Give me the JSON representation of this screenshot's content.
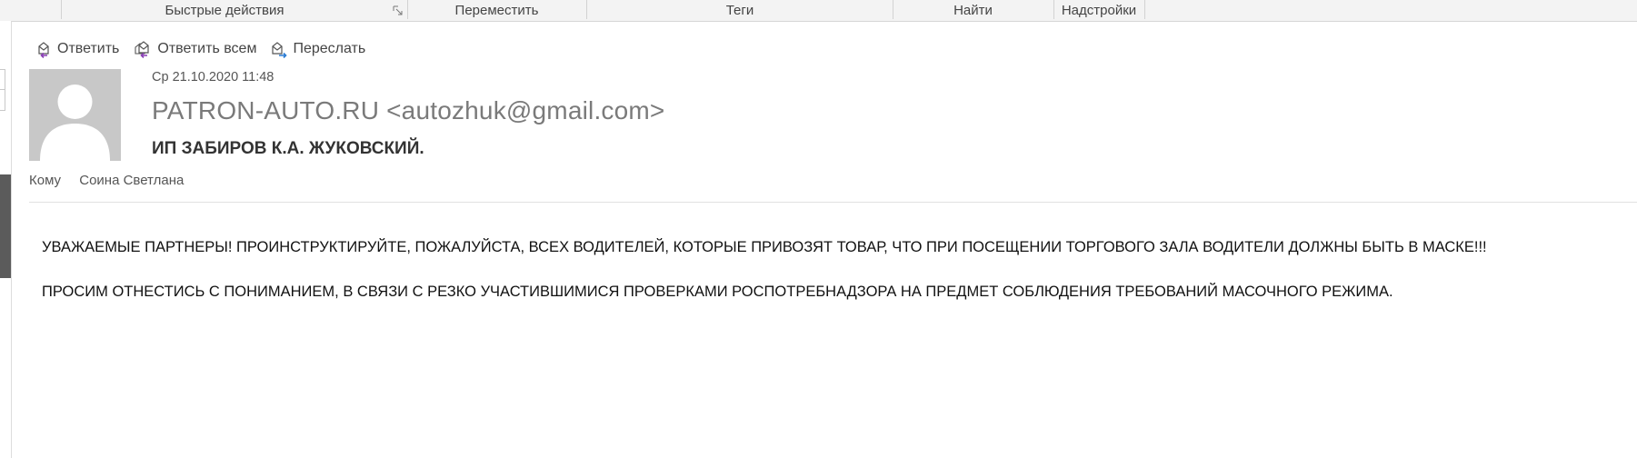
{
  "ribbon": {
    "groups": [
      {
        "label": "Быстрые действия"
      },
      {
        "label": "Переместить"
      },
      {
        "label": "Теги"
      },
      {
        "label": "Найти"
      },
      {
        "label": "Надстройки"
      }
    ]
  },
  "actions": {
    "reply": {
      "label": "Ответить",
      "icon": "reply-icon"
    },
    "reply_all": {
      "label": "Ответить всем",
      "icon": "reply-all-icon"
    },
    "forward": {
      "label": "Переслать",
      "icon": "forward-icon"
    }
  },
  "message": {
    "date": "Ср 21.10.2020 11:48",
    "sender": "PATRON-AUTO.RU <autozhuk@gmail.com>",
    "subject": "ИП ЗАБИРОВ К.А. ЖУКОВСКИЙ.",
    "to_label": "Кому",
    "to_value": "Соина Светлана",
    "body": [
      "УВАЖАЕМЫЕ ПАРТНЕРЫ! ПРОИНСТРУКТИРУЙТЕ, ПОЖАЛУЙСТА, ВСЕХ ВОДИТЕЛЕЙ, КОТОРЫЕ ПРИВОЗЯТ ТОВАР, ЧТО ПРИ ПОСЕЩЕНИИ ТОРГОВОГО ЗАЛА ВОДИТЕЛИ ДОЛЖНЫ БЫТЬ В МАСКЕ!!!",
      "ПРОСИМ ОТНЕСТИСЬ С ПОНИМАНИЕМ, В СВЯЗИ С РЕЗКО УЧАСТИВШИМИСЯ ПРОВЕРКАМИ РОСПОТРЕБНАДЗОРА НА ПРЕДМЕТ СОБЛЮДЕНИЯ ТРЕБОВАНИЙ МАСОЧНОГО РЕЖИМА."
    ]
  },
  "colors": {
    "ribbon_bg": "#f3f3f3",
    "avatar_bg": "#c8c8c8",
    "reply_arrow": "#8a3fb5",
    "forward_arrow": "#2b7cd3"
  }
}
